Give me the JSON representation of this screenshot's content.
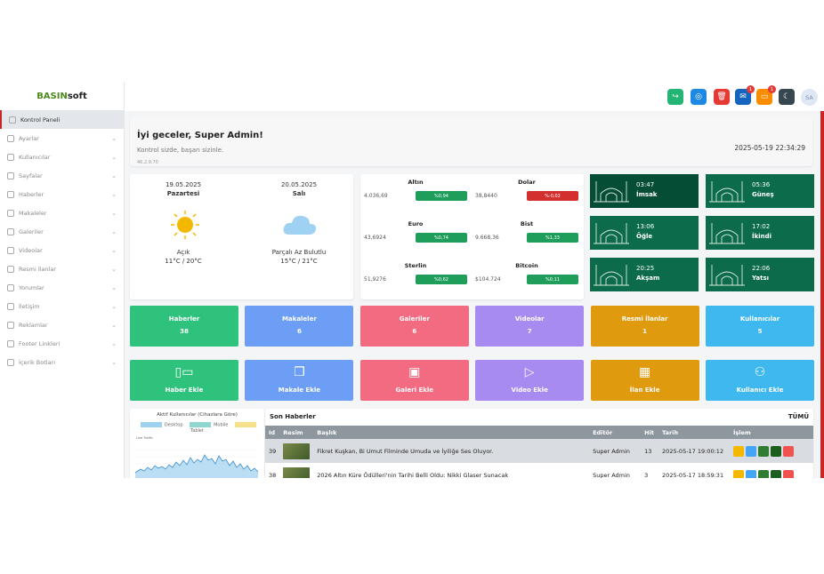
{
  "brand": {
    "bold": "BASIN",
    "rest": "soft"
  },
  "sidebar": {
    "items": [
      {
        "label": "Kontrol Paneli",
        "active": true,
        "expandable": false
      },
      {
        "label": "Ayarlar",
        "expandable": true
      },
      {
        "label": "Kullanıcılar",
        "expandable": true
      },
      {
        "label": "Sayfalar",
        "expandable": true
      },
      {
        "label": "Haberler",
        "expandable": true
      },
      {
        "label": "Makaleler",
        "expandable": true
      },
      {
        "label": "Galeriler",
        "expandable": true
      },
      {
        "label": "Videolar",
        "expandable": true
      },
      {
        "label": "Resmi İlanlar",
        "expandable": true
      },
      {
        "label": "Yorumlar",
        "expandable": true
      },
      {
        "label": "İletişim",
        "expandable": true
      },
      {
        "label": "Reklamlar",
        "expandable": true
      },
      {
        "label": "Footer Linkleri",
        "expandable": true
      },
      {
        "label": "İçerik Botları",
        "expandable": true
      }
    ]
  },
  "topbar": {
    "avatar": "SA",
    "message_badge": "1",
    "comment_badge": "1",
    "colors": {
      "share": "#22b573",
      "globe": "#1e88e5",
      "trash": "#e53935",
      "mail": "#1565c0",
      "comment": "#fb8c00",
      "moon": "#37474f"
    }
  },
  "welcome": {
    "title": "İyi geceler, Super Admin!",
    "subtitle": "Kontrol sizde, başarı sizinle.",
    "version": "46.2.9.70",
    "datetime": "2025-05-19 22:34:29"
  },
  "weather": [
    {
      "date": "19.05.2025",
      "day": "Pazartesi",
      "condition": "Açık",
      "temp": "11°C / 20°C",
      "icon": "sun-icon"
    },
    {
      "date": "20.05.2025",
      "day": "Salı",
      "condition": "Parçalı Az Bulutlu",
      "temp": "15°C / 21°C",
      "icon": "cloud-icon"
    }
  ],
  "currencies": [
    {
      "name": "Altın",
      "value": "4.036,69",
      "change": "%0,94",
      "up": true
    },
    {
      "name": "Dolar",
      "value": "38,8440",
      "change": "%-0,02",
      "up": false
    },
    {
      "name": "Euro",
      "value": "43,6924",
      "change": "%0,74",
      "up": true
    },
    {
      "name": "Bist",
      "value": "9.668,36",
      "change": "%1,33",
      "up": true
    },
    {
      "name": "Sterlin",
      "value": "51,9276",
      "change": "%0,62",
      "up": true
    },
    {
      "name": "Bitcoin",
      "value": "$104.724",
      "change": "%0,11",
      "up": true
    }
  ],
  "prayer_times": [
    {
      "time": "03:47",
      "name": "İmsak",
      "current": true
    },
    {
      "time": "05:36",
      "name": "Güneş"
    },
    {
      "time": "13:06",
      "name": "Öğle"
    },
    {
      "time": "17:02",
      "name": "İkindi"
    },
    {
      "time": "20:25",
      "name": "Akşam"
    },
    {
      "time": "22:06",
      "name": "Yatsı"
    }
  ],
  "stats": [
    {
      "label": "Haberler",
      "value": "38",
      "color": "#2fc27d"
    },
    {
      "label": "Makaleler",
      "value": "6",
      "color": "#6d9ef5"
    },
    {
      "label": "Galeriler",
      "value": "6",
      "color": "#f26b80"
    },
    {
      "label": "Videolar",
      "value": "7",
      "color": "#a78bf0"
    },
    {
      "label": "Resmi İlanlar",
      "value": "1",
      "color": "#e09a0e"
    },
    {
      "label": "Kullanıcılar",
      "value": "5",
      "color": "#3fb8f0"
    }
  ],
  "quick_actions": [
    {
      "label": "Haber Ekle",
      "icon": "news-icon",
      "color": "#2fc27d"
    },
    {
      "label": "Makale Ekle",
      "icon": "document-icon",
      "color": "#6d9ef5"
    },
    {
      "label": "Galeri Ekle",
      "icon": "image-icon",
      "color": "#f26b80"
    },
    {
      "label": "Video Ekle",
      "icon": "video-icon",
      "color": "#a78bf0"
    },
    {
      "label": "İlan Ekle",
      "icon": "calendar-icon",
      "color": "#e09a0e"
    },
    {
      "label": "Kullanıcı Ekle",
      "icon": "users-icon",
      "color": "#3fb8f0"
    }
  ],
  "chart": {
    "title": "Aktif Kullanıcılar (Cihazlara Göre)",
    "legend": [
      {
        "name": "Desktop",
        "color": "#9ed0f0"
      },
      {
        "name": "Mobile",
        "color": "#8fd5d0"
      },
      {
        "name": "Tablet",
        "color": "#f7e08a"
      }
    ],
    "inner_label": "Live Traffic"
  },
  "news": {
    "title": "Son Haberler",
    "all_link": "TÜMÜ",
    "headers": [
      "Id",
      "Resim",
      "Başlık",
      "Editör",
      "Hit",
      "Tarih",
      "İşlem"
    ],
    "rows": [
      {
        "id": "39",
        "title": "Fikret Kuşkan, Bi Umut Filminde Umuda ve İyiliğe Ses Oluyor.",
        "editor": "Super Admin",
        "hit": "13",
        "date": "2025-05-17 19:00:12"
      },
      {
        "id": "38",
        "title": "2026 Altın Küre Ödülleri'nin Tarihi Belli Oldu: Nikki Glaser Sunacak",
        "editor": "Super Admin",
        "hit": "3",
        "date": "2025-05-17 18:59:31"
      }
    ]
  }
}
